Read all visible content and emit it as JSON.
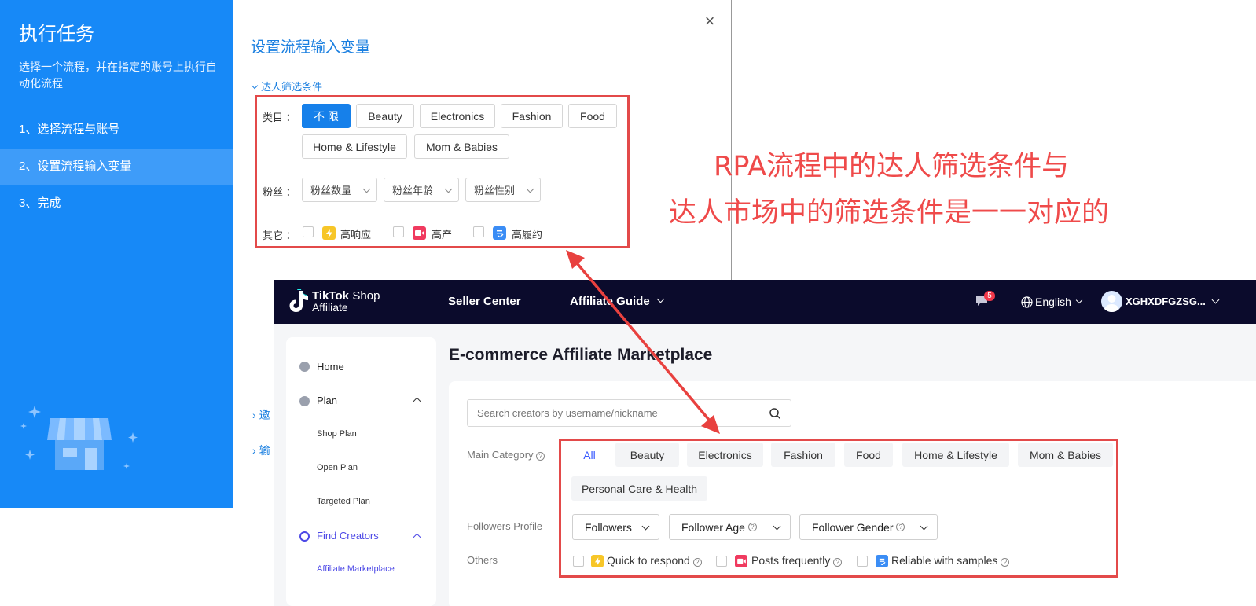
{
  "wizard": {
    "title": "执行任务",
    "description": "选择一个流程，并在指定的账号上执行自动化流程",
    "steps": [
      "1、选择流程与账号",
      "2、设置流程输入变量",
      "3、完成"
    ],
    "active_step": 1
  },
  "dialog": {
    "title": "设置流程输入变量",
    "close_symbol": "×",
    "section": "达人筛选条件",
    "category_label": "类目 ：",
    "categories": [
      "不 限",
      "Beauty",
      "Electronics",
      "Fashion",
      "Food",
      "Home & Lifestyle",
      "Mom & Babies"
    ],
    "fans_label": "粉丝 ：",
    "fans_selects": [
      "粉丝数量",
      "粉丝年龄",
      "粉丝性别"
    ],
    "other_label": "其它 ：",
    "others": [
      "高响应",
      "高产",
      "高履约"
    ],
    "peek_items": [
      "邀",
      "输"
    ]
  },
  "annotation": {
    "line1": "RPA流程中的达人筛选条件与",
    "line2": "达人市场中的筛选条件是一一对应的",
    "color": "#ef4a4a"
  },
  "tiktok": {
    "logo_brand": "TikTok",
    "logo_shop": "Shop",
    "logo_affiliate": "Affiliate",
    "nav": [
      "Seller Center",
      "Affiliate Guide"
    ],
    "notification_count": "5",
    "language": "English",
    "account": "XGHXDFGZSG...",
    "sidebar": {
      "home": "Home",
      "plan": "Plan",
      "plan_items": [
        "Shop Plan",
        "Open Plan",
        "Targeted Plan"
      ],
      "find_creators": "Find Creators",
      "find_items": [
        "Affiliate Marketplace"
      ]
    },
    "page_title": "E-commerce Affiliate Marketplace",
    "search_placeholder": "Search creators by username/nickname",
    "main_category_label": "Main Category",
    "categories": [
      "All",
      "Beauty",
      "Electronics",
      "Fashion",
      "Food",
      "Home & Lifestyle",
      "Mom & Babies",
      "Personal Care & Health"
    ],
    "followers_label": "Followers Profile",
    "followers_dropdowns": [
      "Followers",
      "Follower Age",
      "Follower Gender"
    ],
    "others_label": "Others",
    "others": [
      "Quick to respond",
      "Posts frequently",
      "Reliable with samples"
    ]
  }
}
